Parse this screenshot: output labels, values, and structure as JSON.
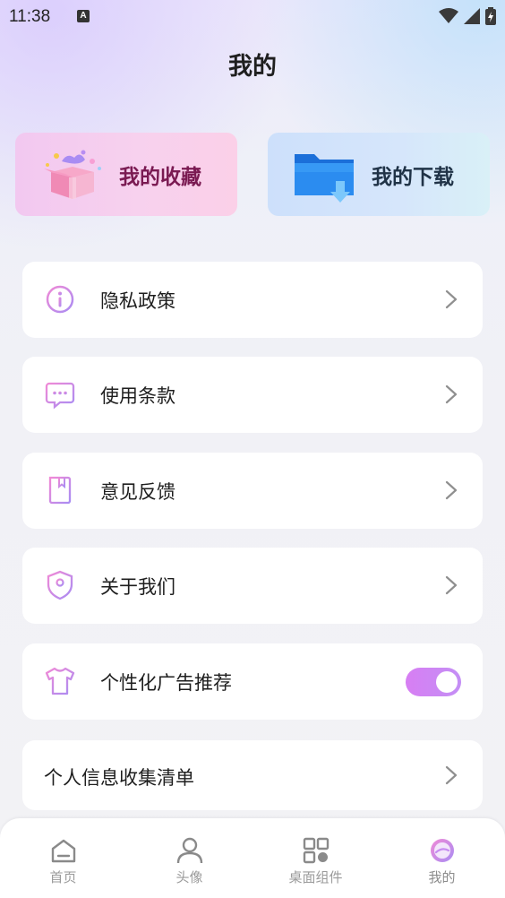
{
  "status_bar": {
    "time": "11:38",
    "notification_badge": "A"
  },
  "header": {
    "title": "我的"
  },
  "top_cards": {
    "favorites": {
      "label": "我的收藏",
      "icon": "gift-box-icon"
    },
    "downloads": {
      "label": "我的下载",
      "icon": "download-folder-icon"
    }
  },
  "menu": {
    "items": [
      {
        "label": "隐私政策",
        "icon": "info-icon"
      },
      {
        "label": "使用条款",
        "icon": "chat-bubble-icon"
      },
      {
        "label": "意见反馈",
        "icon": "book-icon"
      },
      {
        "label": "关于我们",
        "icon": "shield-lock-icon"
      },
      {
        "label": "个性化广告推荐",
        "icon": "tshirt-icon",
        "toggle_on": true
      },
      {
        "label": "个人信息收集清单"
      }
    ]
  },
  "tab_bar": {
    "tabs": [
      {
        "label": "首页",
        "icon": "home-icon"
      },
      {
        "label": "头像",
        "icon": "user-icon"
      },
      {
        "label": "桌面组件",
        "icon": "widgets-icon"
      },
      {
        "label": "我的",
        "icon": "planet-icon",
        "active": true
      }
    ]
  },
  "colors": {
    "accent_start": "#d77ef3",
    "accent_end": "#c48ff5",
    "favorites_text": "#7a1a52"
  }
}
